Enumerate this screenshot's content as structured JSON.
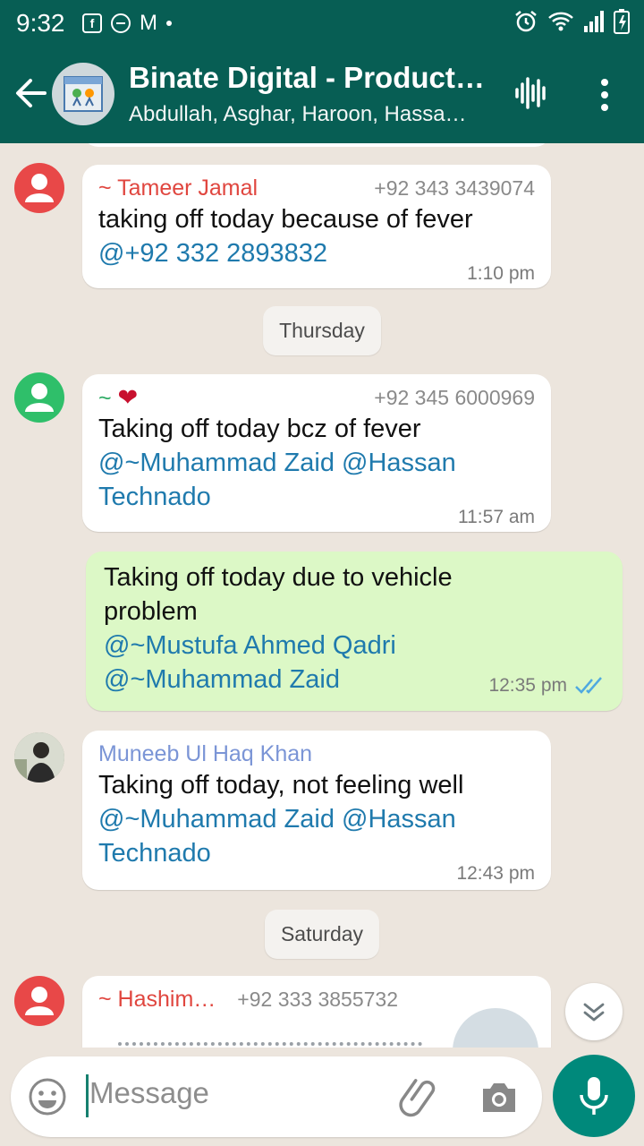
{
  "status_bar": {
    "time": "9:32",
    "fb_icon": "f",
    "gmail_icon": "M"
  },
  "header": {
    "title": "Binate Digital - Product…",
    "subtitle": "Abdullah, Asghar, Haroon, Hassa…"
  },
  "messages": [
    {
      "type": "in",
      "sender": "~ Tameer Jamal",
      "sender_color": "#e0463f",
      "phone": "+92 343 3439074",
      "text": "taking off today because of fever",
      "mentions": [
        "@+92 332 2893832"
      ],
      "time": "1:10 pm"
    },
    {
      "type": "date",
      "label": "Thursday"
    },
    {
      "type": "in",
      "sender": "~ ",
      "sender_emoji": "❤",
      "sender_color": "#2eab64",
      "phone": "+92 345 6000969",
      "text": "Taking off today bcz of fever",
      "mentions": [
        "@~Muhammad Zaid",
        "@Hassan",
        "Technado"
      ],
      "time": "11:57 am"
    },
    {
      "type": "out",
      "text_lines": [
        "Taking off today due to vehicle",
        "problem"
      ],
      "mentions": [
        "@~Mustufa Ahmed Qadri",
        "@~Muhammad Zaid"
      ],
      "time": "12:35 pm",
      "status_icon": "double-check-read"
    },
    {
      "type": "in",
      "sender": "Muneeb Ul Haq Khan",
      "sender_color": "#7b95d6",
      "text": "Taking off today, not feeling well",
      "mentions": [
        "@~Muhammad Zaid",
        "@Hassan",
        "Technado"
      ],
      "time": "12:43 pm"
    },
    {
      "type": "date",
      "label": "Saturday"
    },
    {
      "type": "in",
      "sender": "~ Hashim…",
      "sender_color": "#e0463f",
      "phone": "+92 333 3855732"
    }
  ],
  "input": {
    "placeholder": "Message"
  },
  "colors": {
    "header": "#075e54",
    "chat_bg": "#ece5dd",
    "outgoing": "#dcf8c6",
    "mention": "#1f7aad",
    "fab": "#00897b"
  },
  "icons": [
    "back-arrow-icon",
    "voice-wave-icon",
    "more-vert-icon",
    "emoji-icon",
    "attach-icon",
    "camera-icon",
    "mic-icon",
    "chevron-double-down-icon"
  ]
}
